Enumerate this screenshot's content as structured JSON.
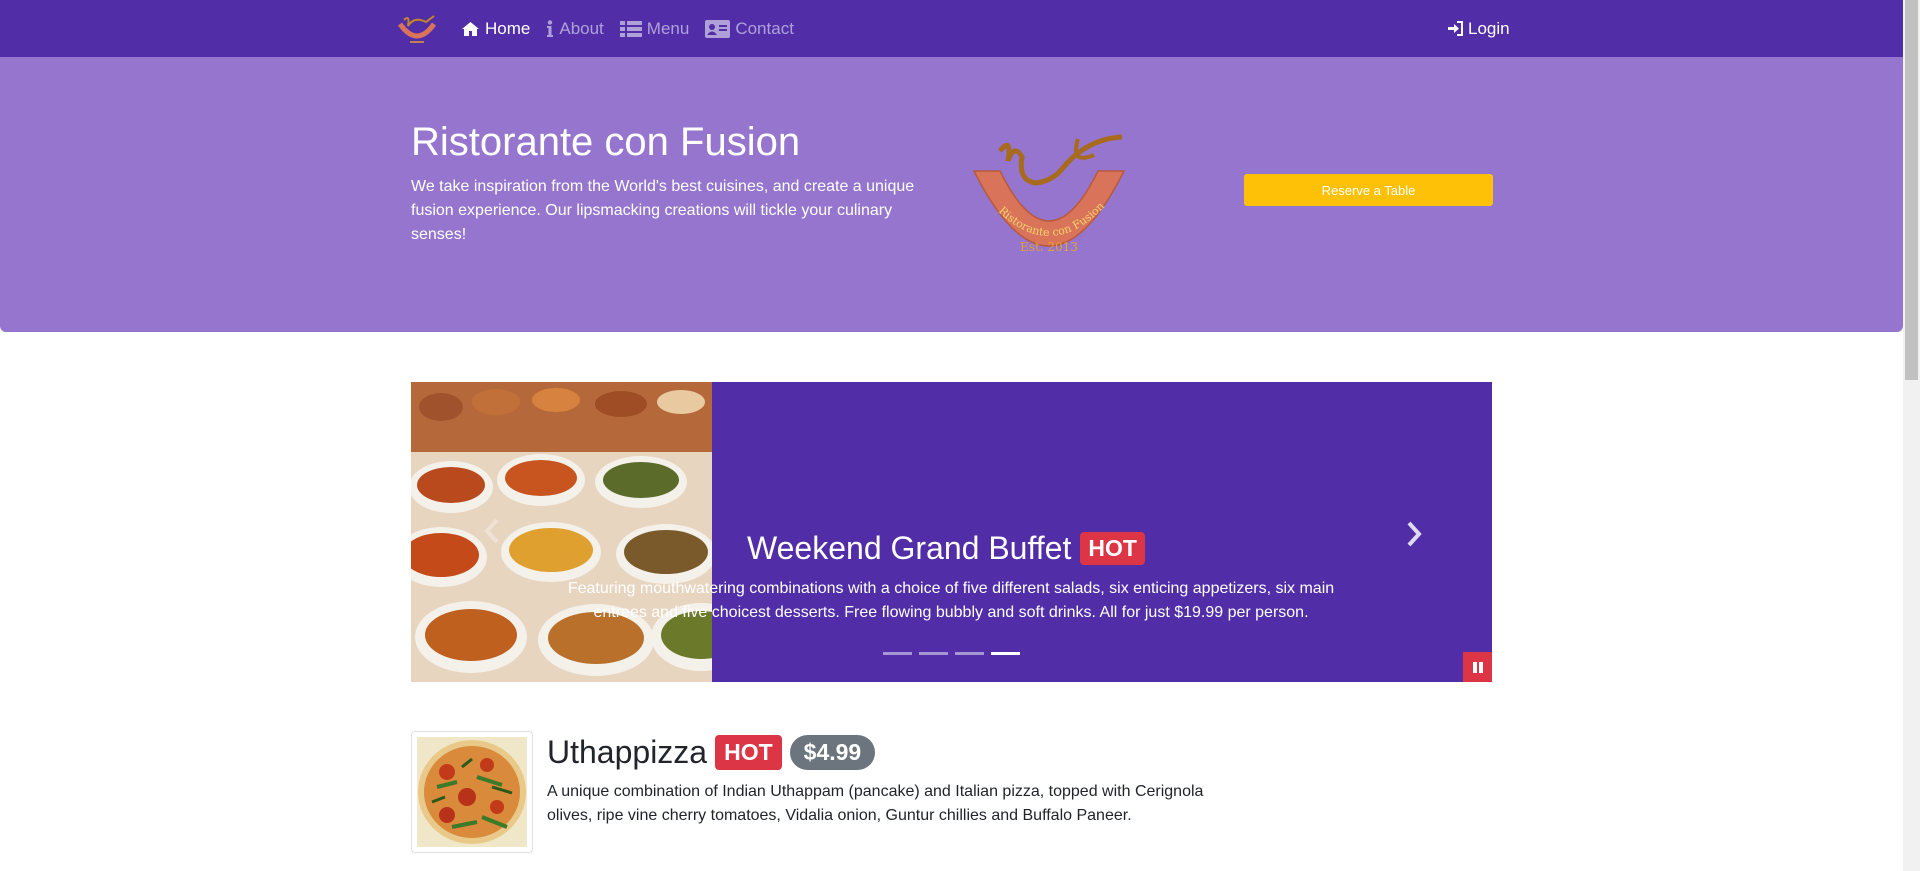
{
  "navbar": {
    "items": [
      {
        "label": "Home",
        "icon": "home-icon",
        "active": true
      },
      {
        "label": "About",
        "icon": "info-icon",
        "active": false
      },
      {
        "label": "Menu",
        "icon": "list-icon",
        "active": false
      },
      {
        "label": "Contact",
        "icon": "address-card-icon",
        "active": false
      }
    ],
    "login_label": "Login"
  },
  "jumbotron": {
    "title": "Ristorante con Fusion",
    "text": "We take inspiration from the World's best cuisines, and create a unique fusion experience. Our lipsmacking creations will tickle your culinary senses!",
    "logo_text": "Ristorante con Fusion",
    "logo_est": "Est. 2013",
    "reserve_label": "Reserve a Table"
  },
  "carousel": {
    "title": "Weekend Grand Buffet",
    "badge": "HOT",
    "text": "Featuring mouthwatering combinations with a choice of five different salads, six enticing appetizers, six main entrees and five choicest desserts. Free flowing bubbly and soft drinks. All for just $19.99 per person.",
    "indicator_count": 4,
    "active_indicator": 4
  },
  "dish": {
    "name": "Uthappizza",
    "badge": "HOT",
    "price": "$4.99",
    "description": "A unique combination of Indian Uthappam (pancake) and Italian pizza, topped with Cerignola olives, ripe vine cherry tomatoes, Vidalia onion, Guntur chillies and Buffalo Paneer."
  },
  "colors": {
    "primary": "#512da8",
    "jumbotron": "#9575cd",
    "warning": "#ffc107",
    "danger": "#dc3545",
    "secondary": "#6c757d"
  }
}
